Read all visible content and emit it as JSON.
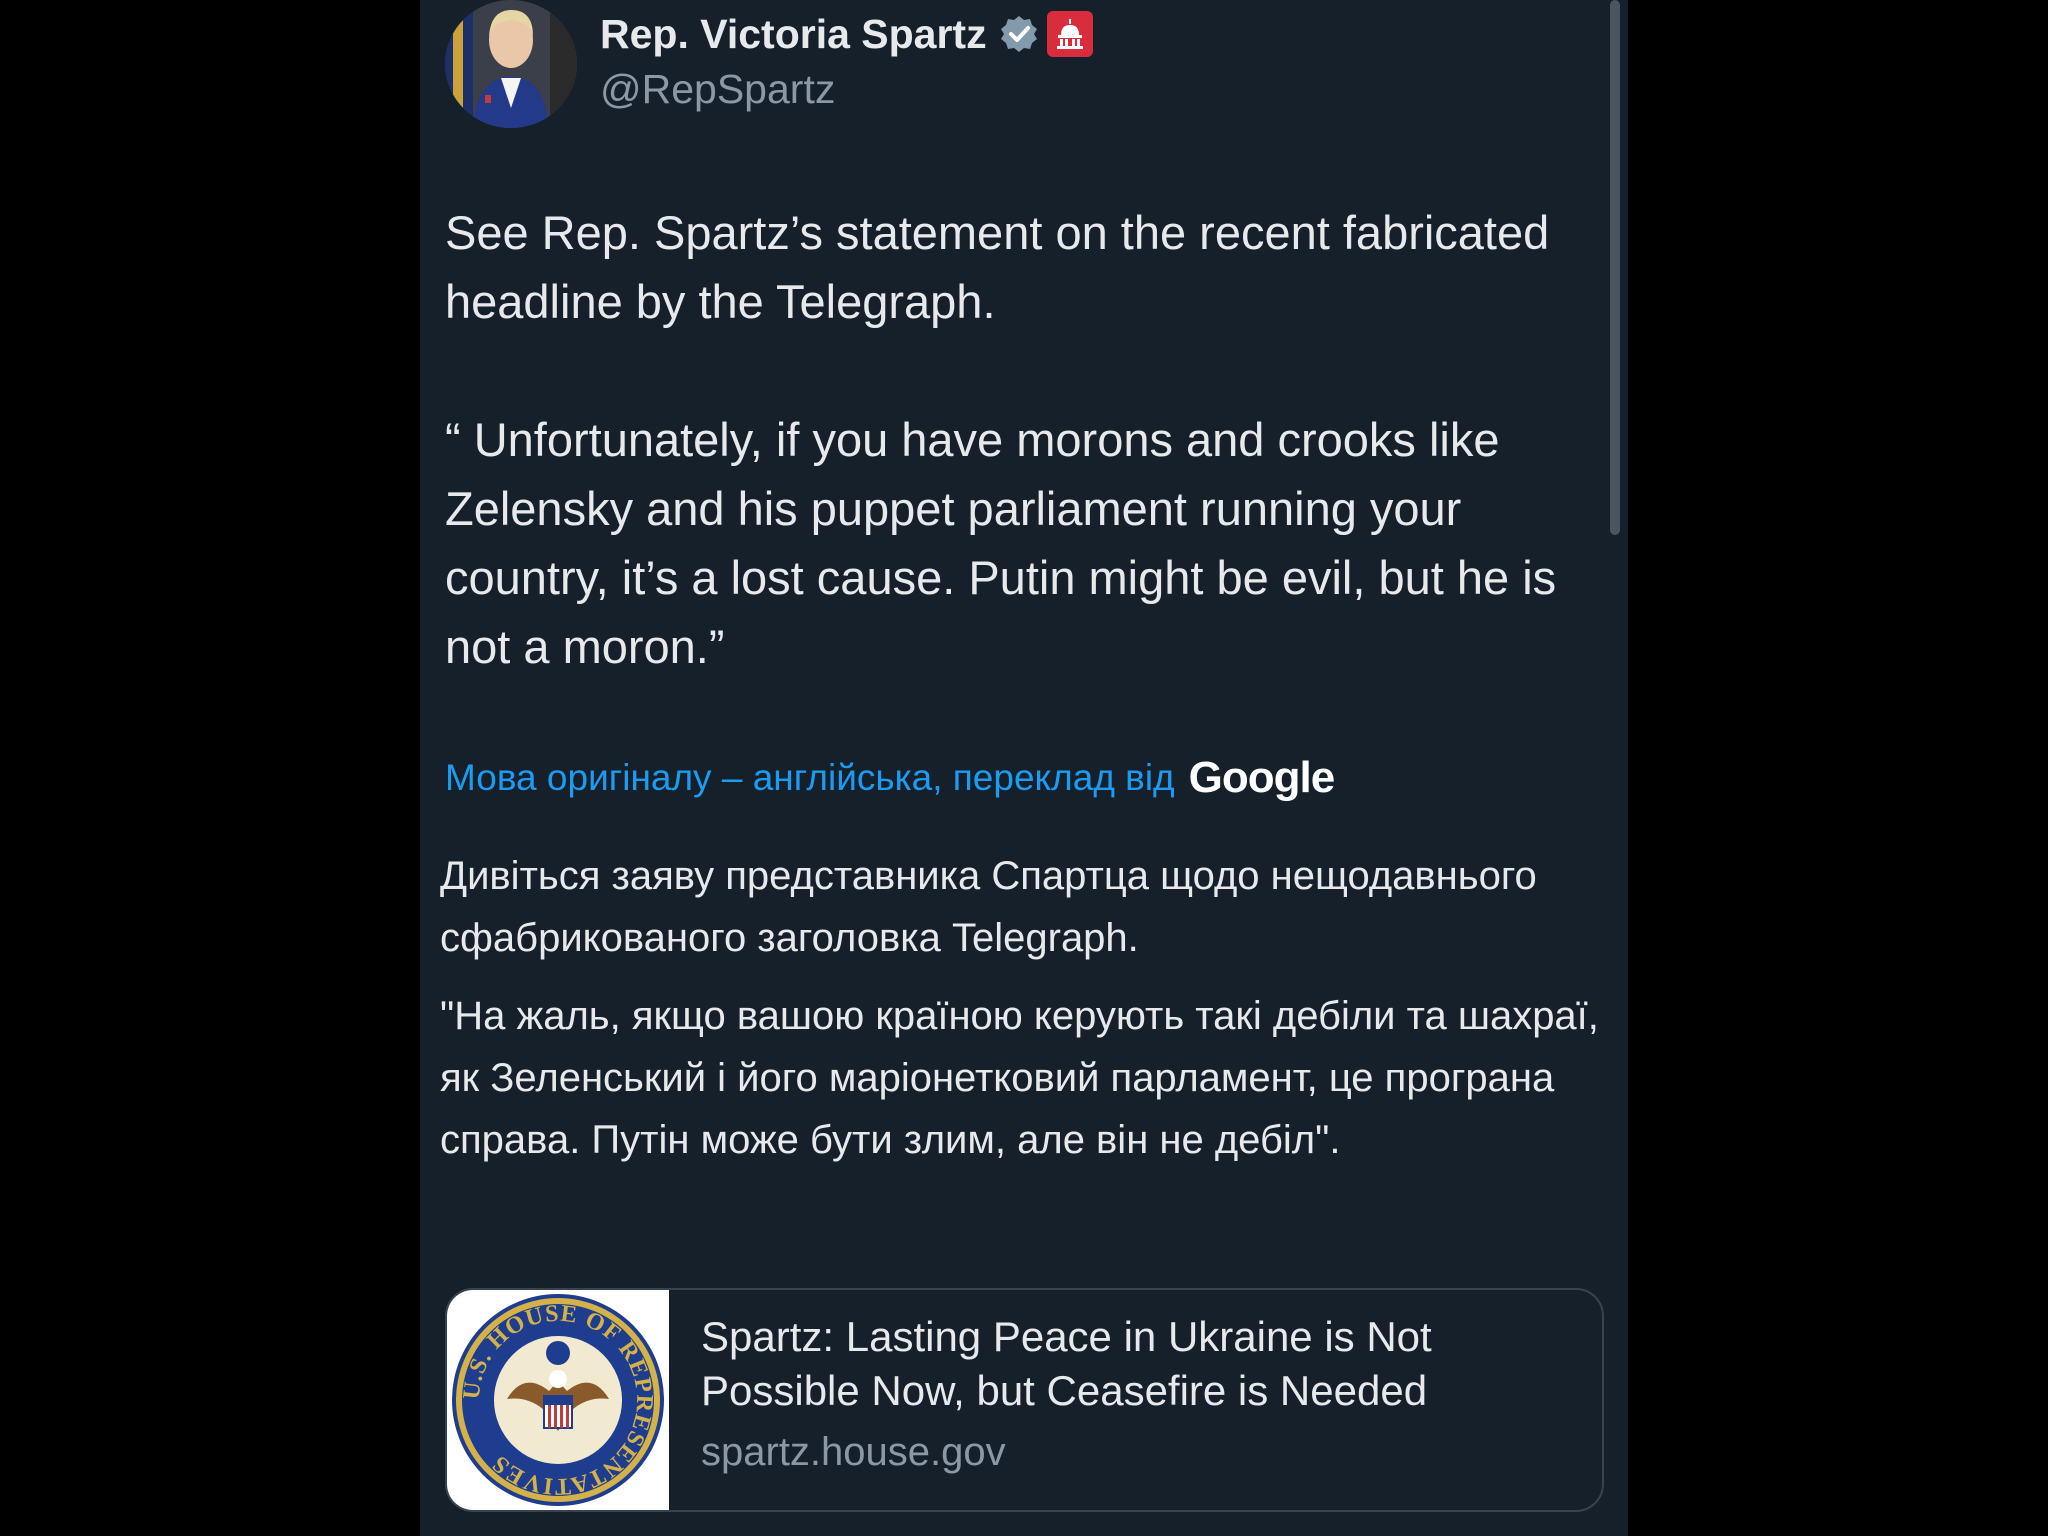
{
  "author": {
    "display_name": "Rep. Victoria Spartz",
    "handle": "@RepSpartz"
  },
  "tweet": {
    "text": "See Rep. Spartz’s statement on the recent fabricated headline by the Telegraph.\n\n“ Unfortunately, if you have morons and crooks like Zelensky and his puppet parliament running your country, it’s a lost cause. Putin might be evil, but he is not a moron.”"
  },
  "translation": {
    "label": "Мова оригіналу – англійська, переклад від",
    "provider": "Google",
    "paragraph_1": "Дивіться заяву представника Спартца щодо нещодавнього сфабрикованого заголовка Telegraph.",
    "paragraph_2": "\"На жаль, якщо вашою країною керують такі дебіли та шахраї, як Зеленський і його маріонетковий парламент, це програна справа. Путін може бути злим, але він не дебіл\"."
  },
  "link_card": {
    "title": "Spartz: Lasting Peace in Ukraine is Not Possible Now, but Ceasefire is Needed",
    "domain": "spartz.house.gov",
    "seal_text": "U.S. HOUSE OF REPRESENTATIVES"
  },
  "colors": {
    "background": "#15202b",
    "link_blue": "#1d9bf0",
    "muted": "#8b98a5",
    "badge_red": "#d92c3c"
  },
  "icons": {
    "verified": "verified-badge-icon",
    "gov": "capitol-icon"
  }
}
